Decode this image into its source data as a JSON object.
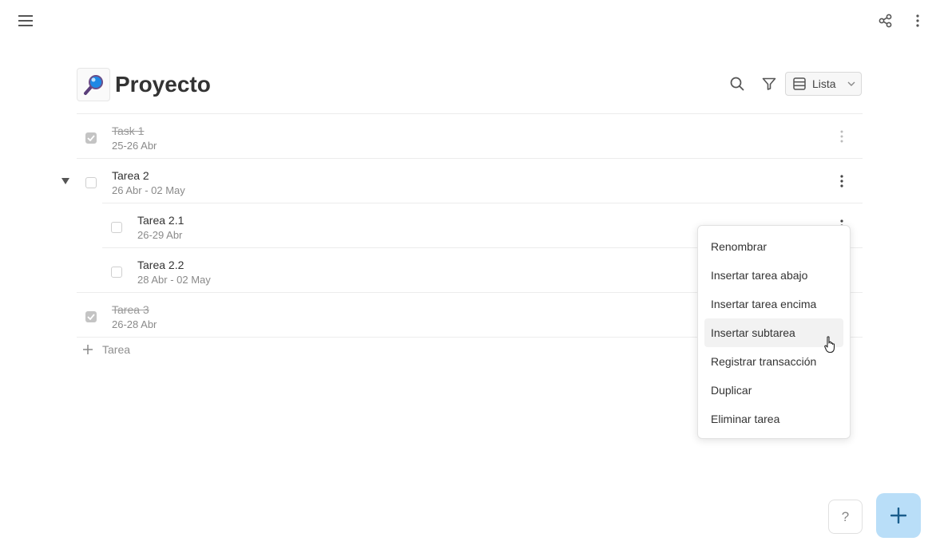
{
  "header": {
    "menu_icon": "hamburger-icon",
    "share_icon": "share-icon",
    "more_icon": "vertical-dots-icon"
  },
  "page": {
    "title": "Proyecto",
    "title_icon": "magnifying-glass-emoji-icon"
  },
  "toolbar": {
    "search_icon": "search-icon",
    "filter_icon": "filter-icon",
    "view_label": "Lista",
    "view_icon": "list-view-icon"
  },
  "tasks": [
    {
      "name": "Task 1",
      "dates": "25-26 Abr",
      "checked": true
    },
    {
      "name": "Tarea 2",
      "dates": "26 Abr - 02 May",
      "checked": false,
      "expanded": true
    },
    {
      "name": "Tarea 2.1",
      "dates": "26-29 Abr",
      "checked": false
    },
    {
      "name": "Tarea 2.2",
      "dates": "28 Abr - 02 May",
      "checked": false
    },
    {
      "name": "Tarea 3",
      "dates": "26-28 Abr",
      "checked": true
    }
  ],
  "add_task_label": "Tarea",
  "context_menu": {
    "items": [
      "Renombrar",
      "Insertar tarea abajo",
      "Insertar tarea encima",
      "Insertar subtarea",
      "Registrar transacción",
      "Duplicar",
      "Eliminar tarea"
    ],
    "hovered": "Insertar subtarea"
  },
  "help_label": "?",
  "fab_icon": "plus-icon",
  "colors": {
    "fab_bg": "#b9def8",
    "fab_icon": "#1a5d8c",
    "checked_box": "#c4c4c4"
  }
}
